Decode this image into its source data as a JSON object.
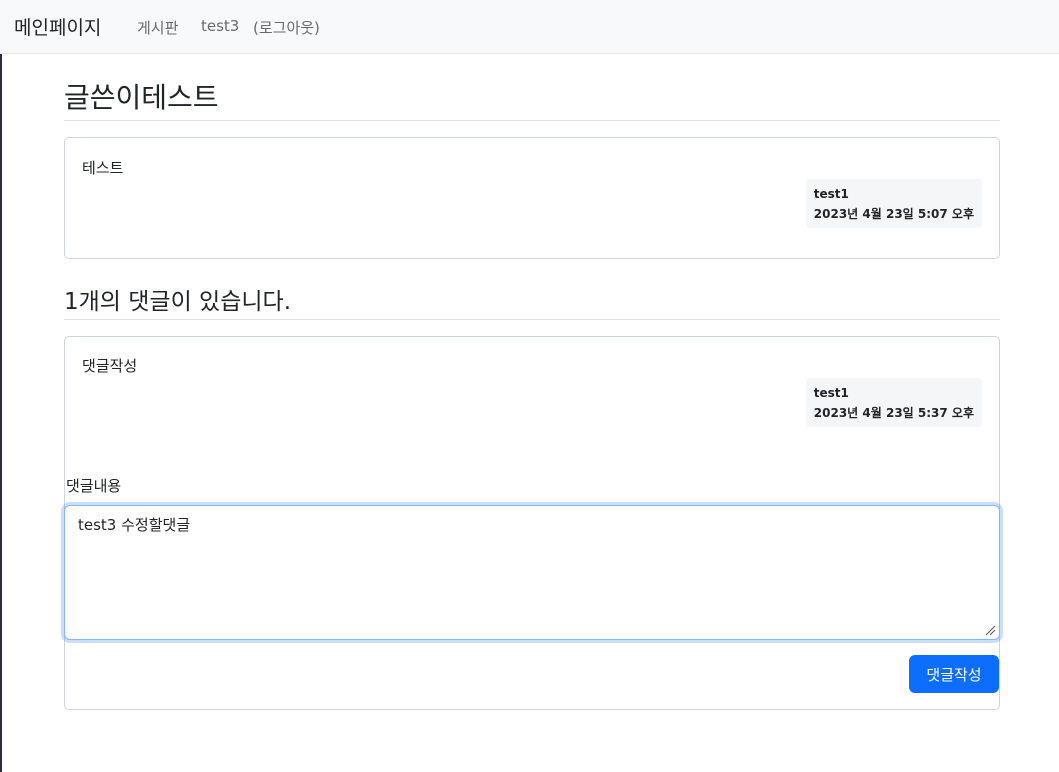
{
  "navbar": {
    "brand": "메인페이지",
    "links": [
      "게시판",
      "test3",
      "(로그아웃)"
    ]
  },
  "post": {
    "title": "글쓴이테스트",
    "content": "테스트",
    "author": "test1",
    "date": "2023년 4월 23일 5:07 오후"
  },
  "comments": {
    "count_text": "1개의 댓글이 있습니다.",
    "items": [
      {
        "content": "댓글작성",
        "author": "test1",
        "date": "2023년 4월 23일 5:37 오후"
      }
    ]
  },
  "comment_form": {
    "label": "댓글내용",
    "value": "test3 수정할댓글",
    "submit_label": "댓글작성"
  },
  "colors": {
    "primary": "#0d6efd",
    "navbar_bg": "#f8f9fa",
    "focus_border": "#86b7fe"
  }
}
